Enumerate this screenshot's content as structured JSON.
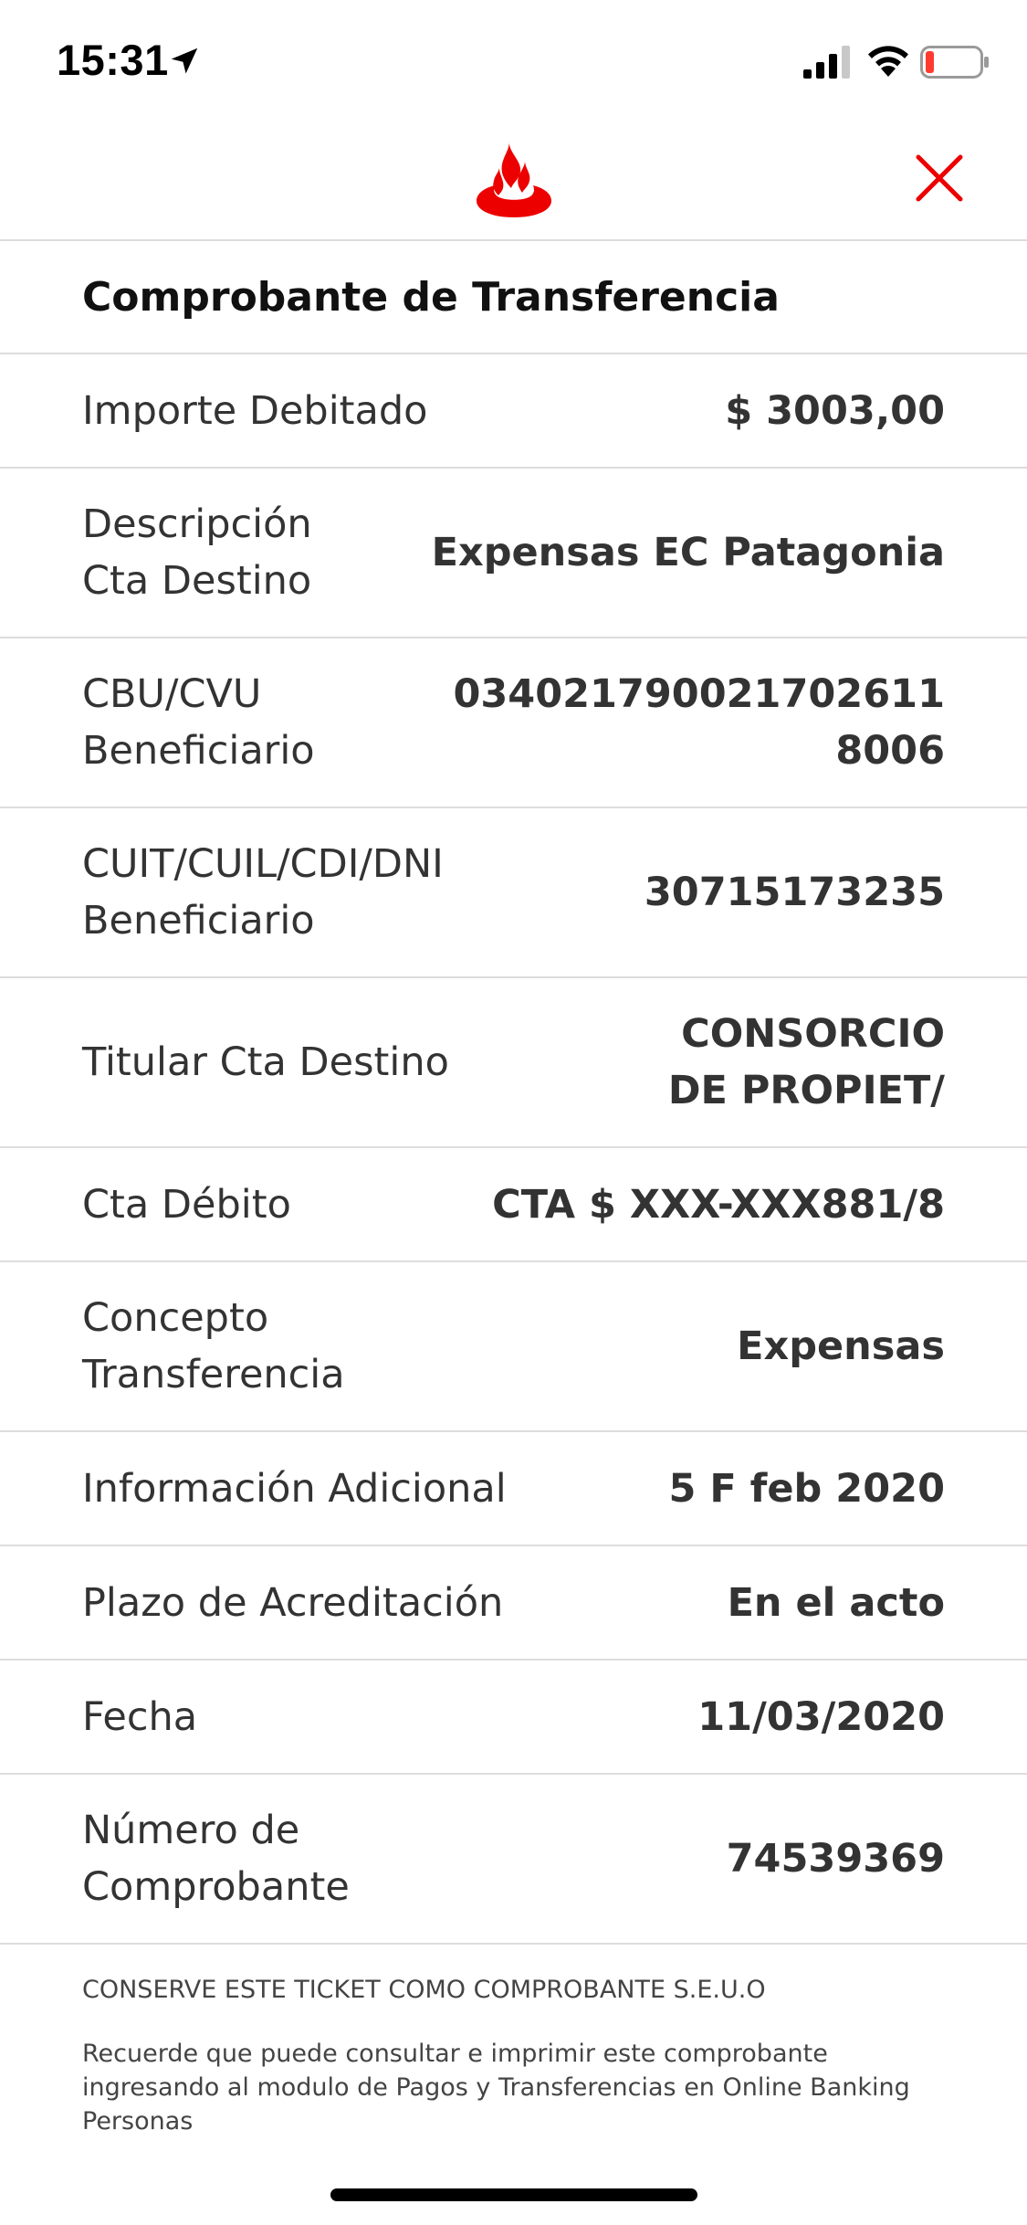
{
  "status_bar": {
    "time": "15:31",
    "icons": [
      "location-arrow-icon",
      "cellular-signal-icon",
      "wifi-icon",
      "battery-low-icon"
    ]
  },
  "header": {
    "logo_icon": "santander-flame-icon",
    "close_icon": "close-icon",
    "accent_color": "#ec0000"
  },
  "receipt": {
    "title": "Comprobante de Transferencia",
    "rows": [
      {
        "label": "Importe Debitado",
        "value": "$ 3003,00"
      },
      {
        "label": "Descripción\nCta Destino",
        "value": "Expensas EC Patagonia"
      },
      {
        "label": "CBU/CVU Beneficiario",
        "value": "034021790021702611\n8006"
      },
      {
        "label": "CUIT/CUIL/CDI/DNI\nBeneficiario",
        "value": "30715173235"
      },
      {
        "label": "Titular Cta Destino",
        "value": "CONSORCIO\nDE PROPIET/"
      },
      {
        "label": "Cta Débito",
        "value": "CTA $ XXX-XXX881/8"
      },
      {
        "label": "Concepto\nTransferencia",
        "value": "Expensas"
      },
      {
        "label": "Información Adicional",
        "value": "5 F feb 2020"
      },
      {
        "label": "Plazo de Acreditación",
        "value": "En el acto"
      },
      {
        "label": "Fecha",
        "value": "11/03/2020"
      },
      {
        "label": "Número de\nComprobante",
        "value": "74539369"
      }
    ]
  },
  "footer": {
    "note_1": "CONSERVE ESTE TICKET COMO COMPROBANTE S.E.U.O",
    "note_2": "Recuerde que puede consultar e imprimir este comprobante ingresando al modulo de Pagos y Transferencias en Online Banking Personas"
  }
}
